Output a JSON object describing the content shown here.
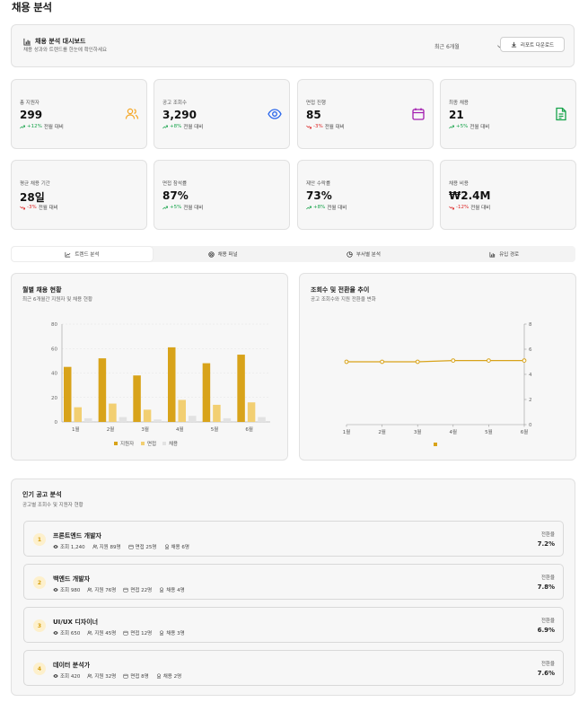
{
  "page_title": "채용 분석",
  "header": {
    "title": "채용 분석 대시보드",
    "subtitle": "채용 성과와 트렌드를 한눈에 확인하세요",
    "period": "최근 6개월",
    "download_label": "리포트 다운로드"
  },
  "stats": [
    {
      "label": "총 지원자",
      "value": "299",
      "change": "+12%",
      "suffix": "전월 대비",
      "direction": "up",
      "icon": "users-icon",
      "color": "#f5a623"
    },
    {
      "label": "공고 조회수",
      "value": "3,290",
      "change": "+8%",
      "suffix": "전월 대비",
      "direction": "up",
      "icon": "eye-icon",
      "color": "#2563eb"
    },
    {
      "label": "면접 진행",
      "value": "85",
      "change": "-3%",
      "suffix": "전월 대비",
      "direction": "down",
      "icon": "calendar-icon",
      "color": "#a21caf"
    },
    {
      "label": "최종 채용",
      "value": "21",
      "change": "+5%",
      "suffix": "전월 대비",
      "direction": "up",
      "icon": "document-icon",
      "color": "#16a34a"
    },
    {
      "label": "평균 채용 기간",
      "value": "28일",
      "change": "-3%",
      "suffix": "전월 대비",
      "direction": "down"
    },
    {
      "label": "면접 참석률",
      "value": "87%",
      "change": "+5%",
      "suffix": "전월 대비",
      "direction": "up"
    },
    {
      "label": "제안 수락률",
      "value": "73%",
      "change": "+8%",
      "suffix": "전월 대비",
      "direction": "up"
    },
    {
      "label": "채용 비용",
      "value": "₩2.4M",
      "change": "-12%",
      "suffix": "전월 대비",
      "direction": "down"
    }
  ],
  "tabs": [
    {
      "label": "트렌드 분석",
      "icon": "trend-icon",
      "active": true
    },
    {
      "label": "채용 퍼널",
      "icon": "target-icon",
      "active": false
    },
    {
      "label": "부서별 분석",
      "icon": "pie-icon",
      "active": false
    },
    {
      "label": "유입 경로",
      "icon": "bar-icon",
      "active": false
    }
  ],
  "monthly_chart": {
    "title": "월별 채용 현황",
    "subtitle": "최근 6개월간 지원자 및 채용 현황",
    "legend": [
      "지원자",
      "면접",
      "채용"
    ]
  },
  "conversion_chart": {
    "title": "조회수 및 전환율 추이",
    "subtitle": "공고 조회수와 지원 전환율 변화"
  },
  "chart_data": [
    {
      "type": "bar",
      "categories": [
        "1월",
        "2월",
        "3월",
        "4월",
        "5월",
        "6월"
      ],
      "series": [
        {
          "name": "지원자",
          "values": [
            45,
            52,
            38,
            61,
            48,
            55
          ],
          "color": "#d8a31a"
        },
        {
          "name": "면접",
          "values": [
            12,
            15,
            10,
            18,
            14,
            16
          ],
          "color": "#f2cf72"
        },
        {
          "name": "채용",
          "values": [
            3,
            4,
            2,
            5,
            3,
            4
          ],
          "color": "#e2e2e2"
        }
      ],
      "ylim": [
        0,
        80
      ],
      "yticks": [
        0,
        20,
        40,
        60,
        80
      ],
      "grid": true,
      "legend_position": "bottom"
    },
    {
      "type": "line",
      "categories": [
        "1월",
        "2월",
        "3월",
        "4월",
        "5월",
        "6월"
      ],
      "series": [
        {
          "values": [
            5.0,
            5.0,
            5.0,
            5.1,
            5.1,
            5.1
          ],
          "color": "#d8a31a"
        }
      ],
      "right_ylim": [
        0,
        8
      ],
      "right_yticks": [
        0,
        2,
        4,
        6,
        8
      ],
      "legend_position": "bottom"
    }
  ],
  "popular": {
    "title": "인기 공고 분석",
    "subtitle": "공고별 조회수 및 지원자 현황",
    "conv_label": "전환율",
    "items": [
      {
        "rank": "1",
        "name": "프론트엔드 개발자",
        "views": "조회 1,240",
        "applicants": "지원 89명",
        "interviews": "면접 25명",
        "hires": "채용 6명",
        "rate": "7.2%"
      },
      {
        "rank": "2",
        "name": "백엔드 개발자",
        "views": "조회 980",
        "applicants": "지원 76명",
        "interviews": "면접 22명",
        "hires": "채용 4명",
        "rate": "7.8%"
      },
      {
        "rank": "3",
        "name": "UI/UX 디자이너",
        "views": "조회 650",
        "applicants": "지원 45명",
        "interviews": "면접 12명",
        "hires": "채용 3명",
        "rate": "6.9%"
      },
      {
        "rank": "4",
        "name": "데이터 분석가",
        "views": "조회 420",
        "applicants": "지원 32명",
        "interviews": "면접 8명",
        "hires": "채용 2명",
        "rate": "7.6%"
      }
    ]
  }
}
